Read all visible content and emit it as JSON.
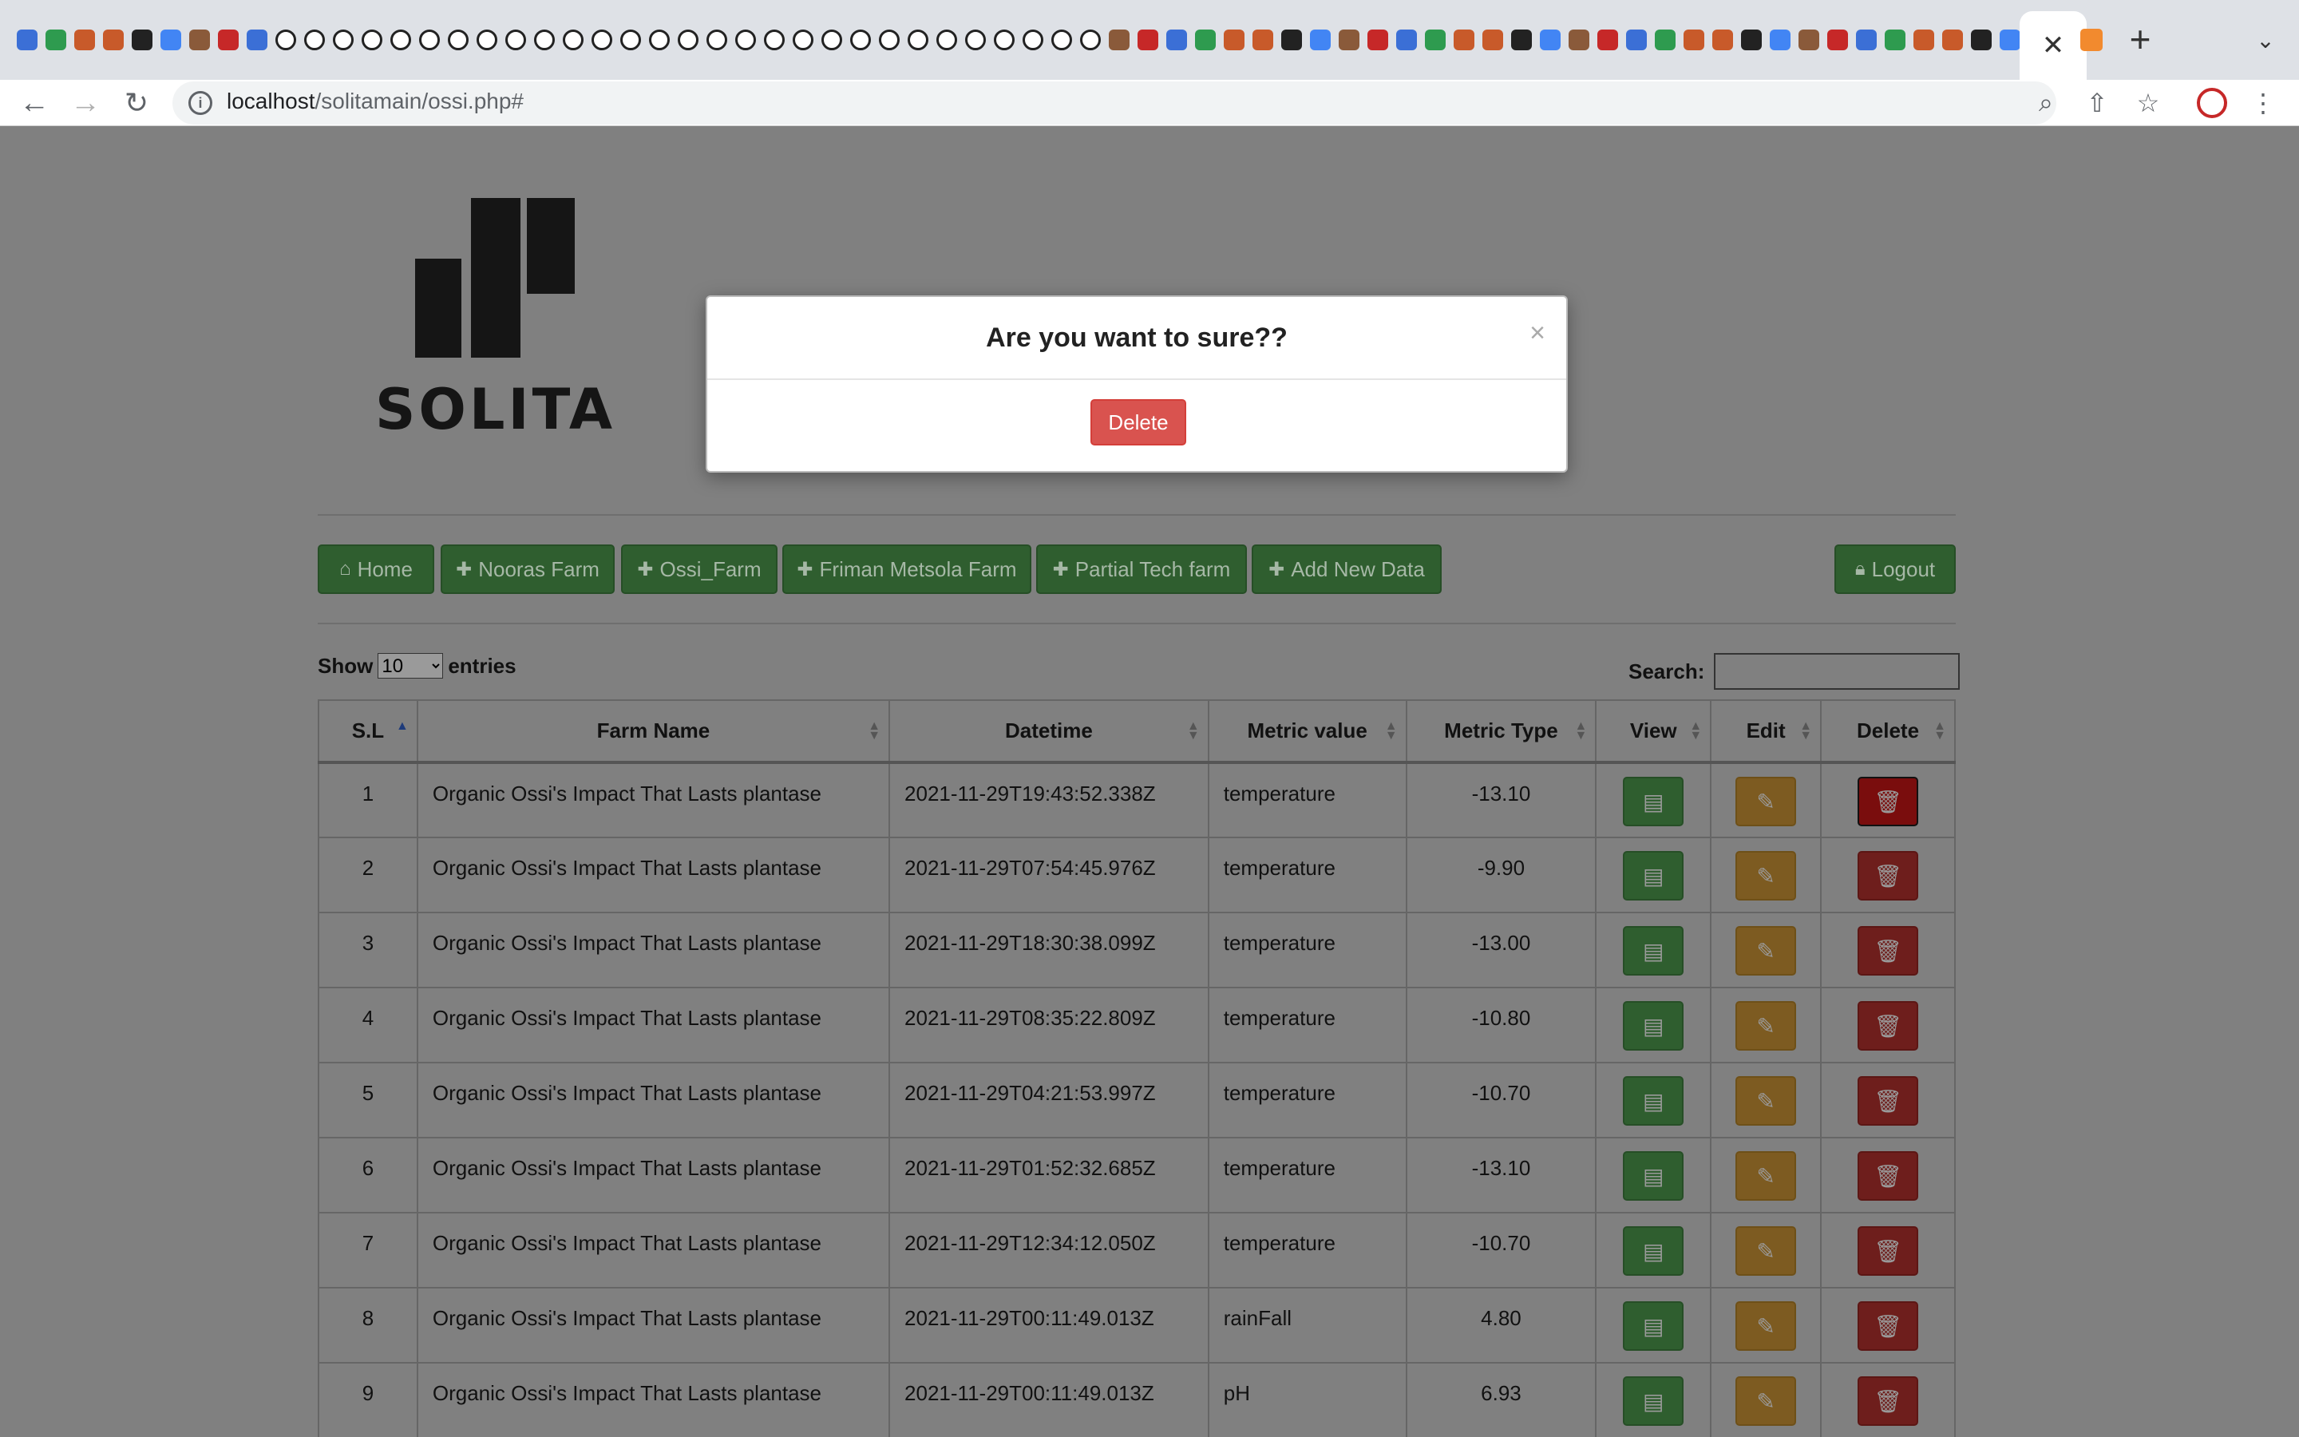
{
  "browser": {
    "active_tab_close": "✕",
    "new_tab": "+",
    "tab_menu": "⌄",
    "url_host": "localhost",
    "url_path": "/solitamain/ossi.php#",
    "colors": {
      "tabstrip": "#dee1e6",
      "omnibox": "#f1f3f4"
    }
  },
  "logo": {
    "text": "SOLITA"
  },
  "nav": {
    "home": "Home",
    "nooras": "Nooras Farm",
    "ossi": "Ossi_Farm",
    "friman": "Friman Metsola Farm",
    "partial": "Partial Tech farm",
    "add": "Add New Data",
    "logout": "Logout"
  },
  "controls": {
    "show_label": "Show",
    "entries_label": "entries",
    "entries_value": "10",
    "search_label": "Search:"
  },
  "table": {
    "headers": [
      "S.L",
      "Farm Name",
      "Datetime",
      "Metric value",
      "Metric Type",
      "View",
      "Edit",
      "Delete"
    ],
    "rows": [
      {
        "sl": "1",
        "farm": "Organic Ossi's Impact That Lasts plantase",
        "datetime": "2021-11-29T19:43:52.338Z",
        "metric": "temperature",
        "type": "-13.10"
      },
      {
        "sl": "2",
        "farm": "Organic Ossi's Impact That Lasts plantase",
        "datetime": "2021-11-29T07:54:45.976Z",
        "metric": "temperature",
        "type": "-9.90"
      },
      {
        "sl": "3",
        "farm": "Organic Ossi's Impact That Lasts plantase",
        "datetime": "2021-11-29T18:30:38.099Z",
        "metric": "temperature",
        "type": "-13.00"
      },
      {
        "sl": "4",
        "farm": "Organic Ossi's Impact That Lasts plantase",
        "datetime": "2021-11-29T08:35:22.809Z",
        "metric": "temperature",
        "type": "-10.80"
      },
      {
        "sl": "5",
        "farm": "Organic Ossi's Impact That Lasts plantase",
        "datetime": "2021-11-29T04:21:53.997Z",
        "metric": "temperature",
        "type": "-10.70"
      },
      {
        "sl": "6",
        "farm": "Organic Ossi's Impact That Lasts plantase",
        "datetime": "2021-11-29T01:52:32.685Z",
        "metric": "temperature",
        "type": "-13.10"
      },
      {
        "sl": "7",
        "farm": "Organic Ossi's Impact That Lasts plantase",
        "datetime": "2021-11-29T12:34:12.050Z",
        "metric": "temperature",
        "type": "-10.70"
      },
      {
        "sl": "8",
        "farm": "Organic Ossi's Impact That Lasts plantase",
        "datetime": "2021-11-29T00:11:49.013Z",
        "metric": "rainFall",
        "type": "4.80"
      },
      {
        "sl": "9",
        "farm": "Organic Ossi's Impact That Lasts plantase",
        "datetime": "2021-11-29T00:11:49.013Z",
        "metric": "pH",
        "type": "6.93"
      }
    ]
  },
  "modal": {
    "title": "Are you want to sure??",
    "close": "×",
    "delete_label": "Delete"
  }
}
